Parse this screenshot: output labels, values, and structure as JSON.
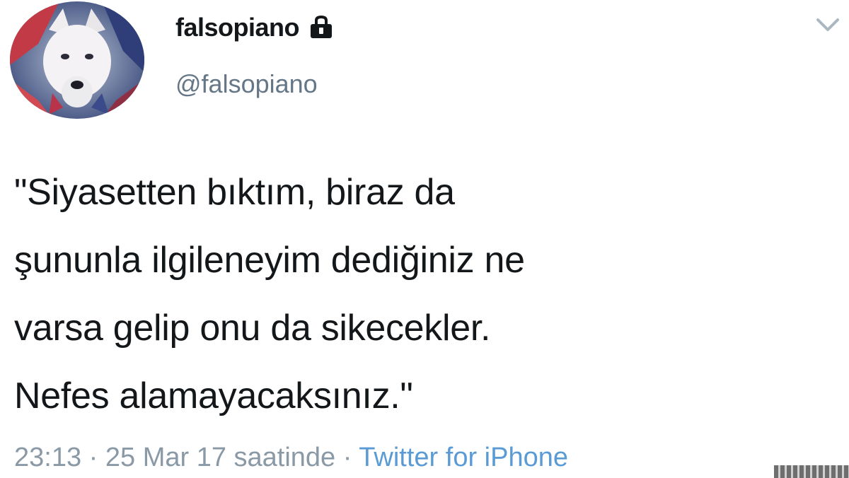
{
  "tweet": {
    "display_name": "falsopiano",
    "handle": "@falsopiano",
    "text": "\"Siyasetten bıktım, biraz da\nşununla ilgileneyim dediğiniz ne\nvarsa gelip onu da sikecekler.\nNefes alamayacaksınız.\"",
    "time": "23:13",
    "date": "25 Mar 17 saatinde",
    "separator_1": "·",
    "separator_2": "·",
    "source": "Twitter for iPhone"
  },
  "icons": {
    "lock": "lock-icon",
    "chevron": "chevron-down-icon",
    "avatar": "avatar"
  },
  "colors": {
    "text": "#14171a",
    "secondary": "#657786",
    "link": "#5b9bd5"
  }
}
